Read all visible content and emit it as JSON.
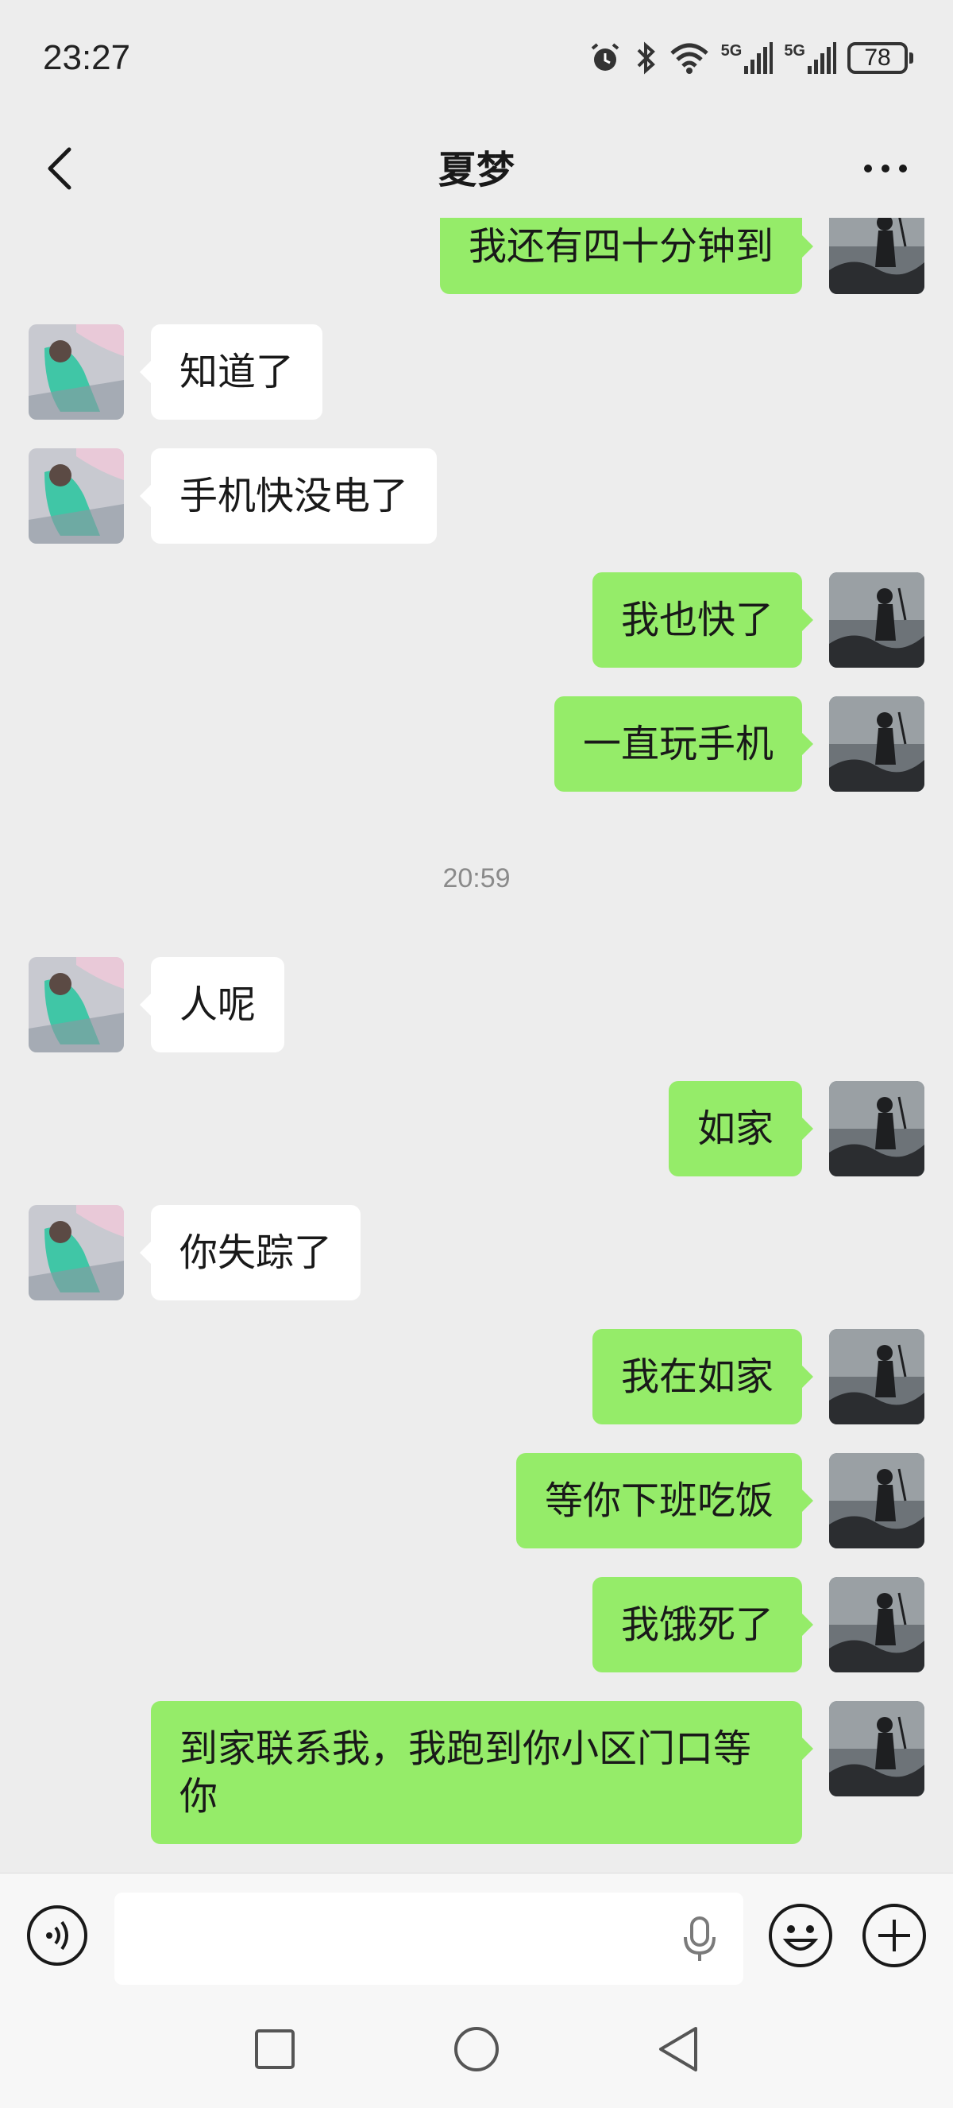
{
  "status_bar": {
    "time": "23:27",
    "network_1": "5G",
    "network_2": "5G",
    "battery": "78"
  },
  "header": {
    "title": "夏梦"
  },
  "timestamp": "20:59",
  "messages": [
    {
      "side": "out",
      "text": "我还有四十分钟到"
    },
    {
      "side": "in",
      "text": "知道了"
    },
    {
      "side": "in",
      "text": "手机快没电了"
    },
    {
      "side": "out",
      "text": "我也快了"
    },
    {
      "side": "out",
      "text": "一直玩手机"
    },
    {
      "side": "in",
      "text": "人呢"
    },
    {
      "side": "out",
      "text": "如家"
    },
    {
      "side": "in",
      "text": "你失踪了"
    },
    {
      "side": "out",
      "text": "我在如家"
    },
    {
      "side": "out",
      "text": "等你下班吃饭"
    },
    {
      "side": "out",
      "text": "我饿死了"
    },
    {
      "side": "out",
      "text": "到家联系我，我跑到你小区门口等你"
    }
  ],
  "input": {
    "value": "",
    "placeholder": ""
  },
  "colors": {
    "background": "#ededed",
    "outgoing_bubble": "#95ec69",
    "incoming_bubble": "#ffffff",
    "input_bar": "#f7f7f7"
  },
  "icons": {
    "back": "chevron-left-icon",
    "more": "more-dots-icon",
    "voice": "voice-mode-icon",
    "mic": "microphone-icon",
    "emoji": "emoji-icon",
    "plus": "plus-icon",
    "nav_recent": "square-icon",
    "nav_home": "circle-icon",
    "nav_back": "triangle-back-icon"
  }
}
